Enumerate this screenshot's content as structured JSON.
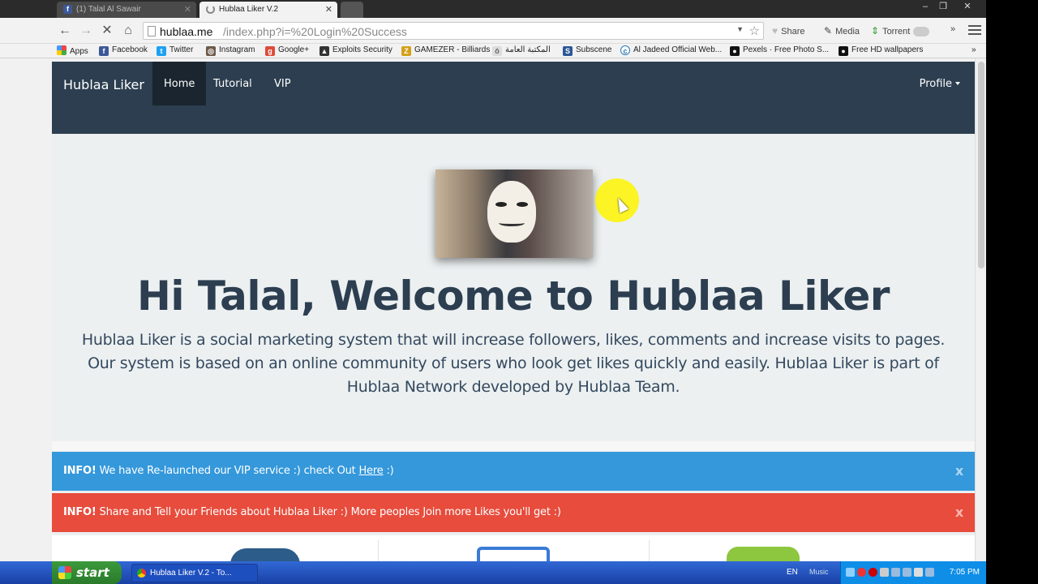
{
  "browser": {
    "tabs": [
      {
        "title": "(1) Talal Al Sawair"
      },
      {
        "title": "Hublaa Liker V.2"
      }
    ],
    "url_host": "hublaa.me",
    "url_path": "/index.php?i=%20Login%20Success",
    "extensions": [
      {
        "label": "Share",
        "icon": "heart-icon"
      },
      {
        "label": "Media",
        "icon": "pen-icon"
      },
      {
        "label": "Torrent",
        "icon": "arrows-icon"
      }
    ],
    "bookmarks": [
      {
        "label": "Apps"
      },
      {
        "label": "Facebook"
      },
      {
        "label": "Twitter"
      },
      {
        "label": "Instagram"
      },
      {
        "label": "Google+"
      },
      {
        "label": "Exploits Security"
      },
      {
        "label": "GAMEZER - Billiards"
      },
      {
        "label": "المكتبة العامة"
      },
      {
        "label": "Subscene"
      },
      {
        "label": "Al Jadeed Official Web..."
      },
      {
        "label": "Pexels · Free Photo S..."
      },
      {
        "label": "Free HD wallpapers"
      }
    ],
    "overflow": "»"
  },
  "site": {
    "brand": "Hublaa Liker",
    "nav": {
      "home": "Home",
      "tutorial": "Tutorial",
      "vip": "VIP",
      "profile": "Profile"
    },
    "heading": "Hi Talal, Welcome to Hublaa Liker",
    "intro": "Hublaa Liker is a social marketing system that will increase followers, likes, comments and increase visits to pages. Our system is based on an online community of users who look get likes quickly and easily. Hublaa Liker is part of Hublaa Network developed by Hublaa Team.",
    "alert_info": {
      "label": "INFO!",
      "text": "We have Re-launched our VIP service :) check Out",
      "link": "Here",
      "suffix": ":)",
      "close": "x"
    },
    "alert_danger": {
      "label": "INFO!",
      "text": "Share and Tell your Friends about Hublaa Liker :) More peoples Join more Likes you'll get :)",
      "close": "x"
    },
    "colors": {
      "navbar": "#2c3e50",
      "info": "#3498db",
      "danger": "#e74c3c"
    }
  },
  "taskbar": {
    "start": "start",
    "task": "Hublaa Liker V.2 - To...",
    "lang": "EN",
    "music": "Music",
    "clock": "7:05 PM"
  }
}
